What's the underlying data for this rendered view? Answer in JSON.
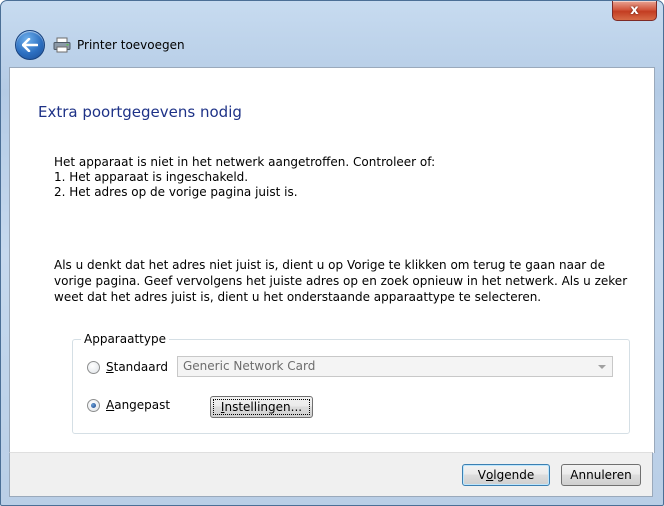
{
  "window": {
    "title": "Printer toevoegen",
    "close_label": "x"
  },
  "icons": {
    "back": "back-arrow-icon",
    "printer": "printer-icon",
    "close": "close-icon"
  },
  "page": {
    "heading": "Extra poortgegevens nodig",
    "intro_lines": [
      "Het apparaat is niet in het netwerk aangetroffen. Controleer of:",
      "1. Het apparaat is ingeschakeld.",
      "2. Het adres op de vorige pagina juist is."
    ],
    "instructions": "Als u denkt dat het adres niet juist is, dient u op Vorige te klikken om terug te gaan naar de vorige pagina. Geef vervolgens het juiste adres op en zoek opnieuw in het netwerk. Als u zeker weet dat het adres juist is, dient u het onderstaande apparaattype te selecteren."
  },
  "device_type": {
    "legend": "Apparaattype",
    "standard_label_u": "S",
    "standard_label_rest": "tandaard",
    "standard_checked": false,
    "standard_select_value": "Generic Network Card",
    "custom_label_u": "A",
    "custom_label_rest": "angepast",
    "custom_checked": true,
    "settings_button_u": "I",
    "settings_button_rest": "nstellingen..."
  },
  "footer": {
    "next_pre": "V",
    "next_u": "o",
    "next_rest": "lgende",
    "cancel_label": "Annuleren"
  },
  "colors": {
    "heading": "#1e3287",
    "frame": "#b9cee6",
    "close": "#c33d22"
  }
}
